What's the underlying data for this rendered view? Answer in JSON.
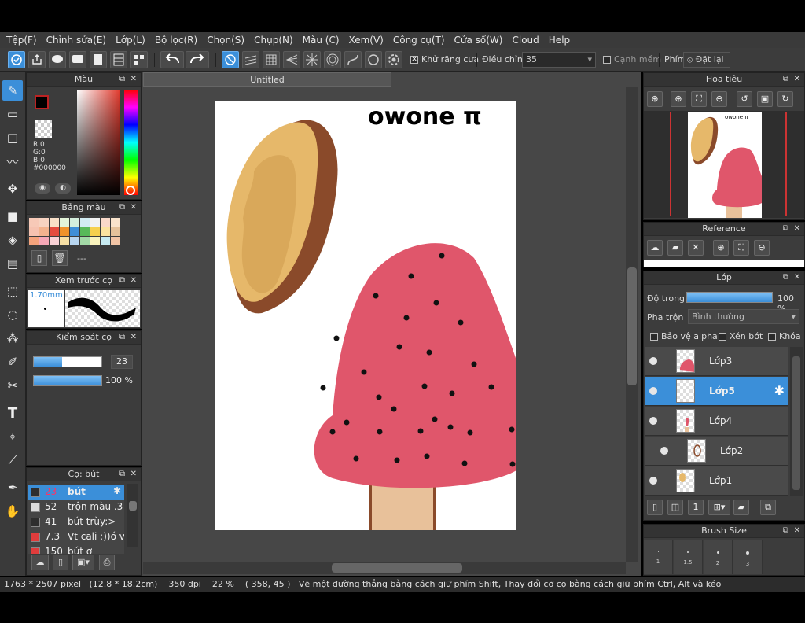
{
  "menu": [
    "Tệp(F)",
    "Chỉnh sửa(E)",
    "Lớp(L)",
    "Bộ lọc(R)",
    "Chọn(S)",
    "Chụp(N)",
    "Màu (C)",
    "Xem(V)",
    "Công cụ(T)",
    "Cửa sổ(W)",
    "Cloud",
    "Help"
  ],
  "toolbar": {
    "antialias_label": "Khử răng cưa",
    "adjust_label": "Điều chỉnh",
    "adjust_value": "35",
    "soft_edge_label": "Cạnh mềm",
    "key_label": "Phím",
    "reset_label": "Đặt lại"
  },
  "color_panel": {
    "title": "Màu",
    "r": "R:0",
    "g": "G:0",
    "b": "B:0",
    "hex": "#000000",
    "primary": "#000000",
    "secondary": "#e0455a"
  },
  "palette_panel": {
    "title": "Bảng màu",
    "dashes": "---",
    "swatches": [
      "#f7c9b7",
      "#f7d3c1",
      "#f9e0c8",
      "#e3f4d8",
      "#d4eedd",
      "#d2ecf2",
      "#f2f2f2",
      "#f9d8c9",
      "#f9e3cc",
      "#f6c2b0",
      "#f3b38e",
      "#e44b3f",
      "#f0932b",
      "#3f8fd8",
      "#58b959",
      "#f6d04e",
      "#fbe29f",
      "#e5c29b",
      "#f4a37c",
      "#f6a8b7",
      "#fad2d7",
      "#f7e0a5",
      "#b8d6f0",
      "#a3d9a6",
      "#f9f3bd",
      "#c7eaf1",
      "#f2c5a6"
    ]
  },
  "preview_panel": {
    "title": "Xem trước cọ",
    "size": "1.70mm"
  },
  "brush_control_panel": {
    "title": "Kiểm soát cọ",
    "size_value": "23",
    "size_fraction": 0.42,
    "opacity_value": "100 %",
    "opacity_fraction": 1.0
  },
  "brush_list_panel": {
    "title": "Cọ: bút",
    "items": [
      {
        "num": "23",
        "label": "bút",
        "color": "#2e2e2e",
        "selected": true
      },
      {
        "num": "52",
        "label": "trộn màu .3",
        "color": "#dddddd",
        "selected": false
      },
      {
        "num": "41",
        "label": "bút trùy:>",
        "color": "#2e2e2e",
        "selected": false
      },
      {
        "num": "7.3",
        "label": "Vt cali :))ó vẽ",
        "color": "#e03c3c",
        "selected": false
      },
      {
        "num": "150",
        "label": "bút ơ",
        "color": "#e03c3c",
        "selected": false
      }
    ]
  },
  "document": {
    "tab_title": "Untitled",
    "canvas_text": "owone π"
  },
  "navigator_panel": {
    "title": "Hoa tiêu"
  },
  "reference_panel": {
    "title": "Reference"
  },
  "layer_panel": {
    "title": "Lớp",
    "opacity_label": "Độ trong",
    "opacity_value": "100 %",
    "opacity_fraction": 1.0,
    "blend_label": "Pha trộn",
    "blend_value": "Bình thường",
    "protect_alpha": "Bảo vệ alpha",
    "clip": "Xén bớt",
    "lock": "Khóa",
    "layers": [
      {
        "name": "Lớp3",
        "selected": false
      },
      {
        "name": "Lớp5",
        "selected": true
      },
      {
        "name": "Lớp4",
        "selected": false
      },
      {
        "name": "Lớp2",
        "selected": false
      },
      {
        "name": "Lớp1",
        "selected": false
      }
    ]
  },
  "brush_size_panel": {
    "title": "Brush Size",
    "sizes": [
      "1",
      "1.5",
      "2",
      "3"
    ]
  },
  "status": {
    "dims": "1763 * 2507 pixel",
    "physical": "(12.8 * 18.2cm)",
    "dpi": "350 dpi",
    "zoom": "22 %",
    "cursor": "( 358, 45 )",
    "hint": "Vẽ một đường thẳng bằng cách giữ phím Shift, Thay đổi cỡ cọ bằng cách giữ phím Ctrl, Alt và kéo"
  },
  "colors": {
    "accent": "#3b8fd9",
    "mushroom": "#e0566b",
    "stem": "#e8c19a",
    "bread": "#e2b264",
    "crust": "#8a4a2a"
  }
}
